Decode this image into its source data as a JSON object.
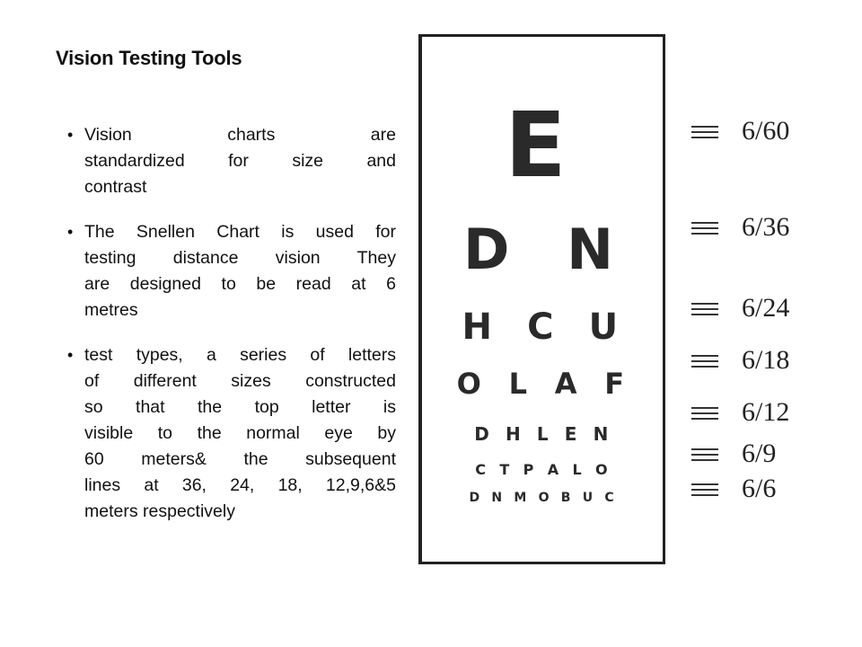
{
  "title": "Vision Testing Tools",
  "bullets": [
    {
      "lines": [
        "Vision charts are",
        "standardized for size and",
        "contrast"
      ]
    },
    {
      "lines": [
        "The Snellen Chart is used for",
        "testing distance vision They",
        "are designed to be read at 6",
        "metres"
      ]
    },
    {
      "lines": [
        "test types, a series of  letters",
        "of different sizes constructed",
        "so that the top letter is",
        "visible to the normal eye by",
        "60 meters& the subsequent",
        "lines at 36, 24, 18, 12,9,6&5",
        "meters respectively"
      ]
    }
  ],
  "chart": {
    "rows": [
      "E",
      "D N",
      "H C U",
      "O L A F",
      "D H L E N",
      "C T P A L O",
      "D N M O B U C"
    ],
    "labels": [
      "6/60",
      "6/36",
      "6/24",
      "6/18",
      "6/12",
      "6/9",
      "6/6"
    ]
  }
}
